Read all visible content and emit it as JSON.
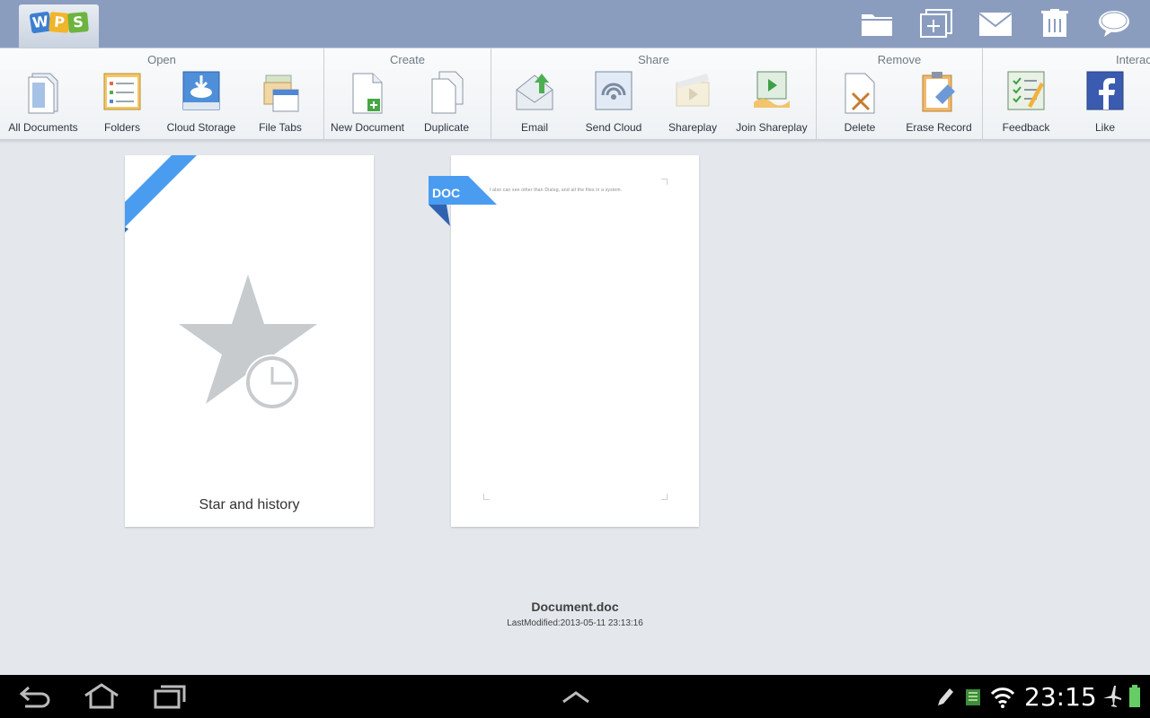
{
  "colors": {
    "topbar": "#8b9dbf",
    "ribbon_bg": "#f4f6f8",
    "accent_blue": "#4a9cf0",
    "navbar": "#000000"
  },
  "app": {
    "logo_letters": [
      "W",
      "P",
      "S"
    ]
  },
  "top_actions": [
    "folder-icon",
    "new-tab-icon",
    "mail-icon",
    "trash-icon",
    "comment-icon"
  ],
  "ribbon": {
    "open": {
      "title": "Open",
      "tools": [
        "All Documents",
        "Folders",
        "Cloud Storage",
        "File Tabs"
      ]
    },
    "create": {
      "title": "Create",
      "tools": [
        "New Document",
        "Duplicate"
      ]
    },
    "share": {
      "title": "Share",
      "tools": [
        "Email",
        "Send Cloud",
        "Shareplay",
        "Join Shareplay"
      ]
    },
    "remove": {
      "title": "Remove",
      "tools": [
        "Delete",
        "Erase Record"
      ]
    },
    "interact": {
      "title": "Interac",
      "tools": [
        "Feedback",
        "Like"
      ]
    }
  },
  "cards": {
    "star": {
      "caption": "Star and history"
    },
    "doc": {
      "badge": "DOC",
      "preview_text": "I also can see other than Dialog, and all the files in a system.",
      "name": "Document.doc",
      "modified": "LastModified:2013-05-11 23:13:16"
    }
  },
  "statusbar": {
    "time": "23:15"
  }
}
